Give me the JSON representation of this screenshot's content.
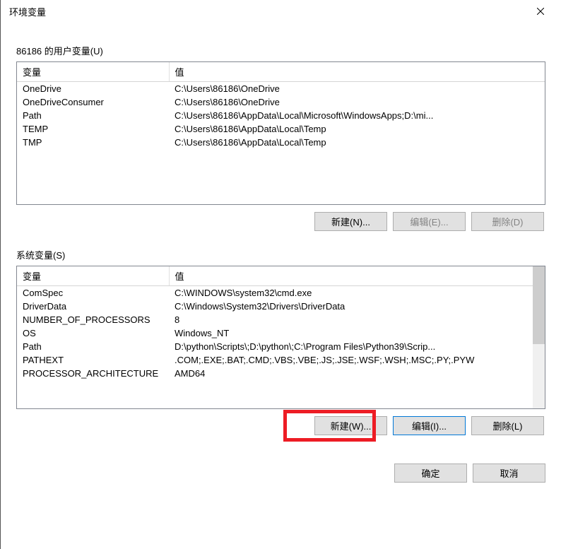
{
  "window": {
    "title": "环境变量"
  },
  "user_section": {
    "label": "86186 的用户变量(U)",
    "columns": {
      "variable": "变量",
      "value": "值"
    },
    "rows": [
      {
        "variable": "OneDrive",
        "value": "C:\\Users\\86186\\OneDrive"
      },
      {
        "variable": "OneDriveConsumer",
        "value": "C:\\Users\\86186\\OneDrive"
      },
      {
        "variable": "Path",
        "value": "C:\\Users\\86186\\AppData\\Local\\Microsoft\\WindowsApps;D:\\mi..."
      },
      {
        "variable": "TEMP",
        "value": "C:\\Users\\86186\\AppData\\Local\\Temp"
      },
      {
        "variable": "TMP",
        "value": "C:\\Users\\86186\\AppData\\Local\\Temp"
      }
    ],
    "buttons": {
      "new": "新建(N)...",
      "edit": "编辑(E)...",
      "delete": "删除(D)"
    }
  },
  "system_section": {
    "label": "系统变量(S)",
    "columns": {
      "variable": "变量",
      "value": "值"
    },
    "rows": [
      {
        "variable": "ComSpec",
        "value": "C:\\WINDOWS\\system32\\cmd.exe"
      },
      {
        "variable": "DriverData",
        "value": "C:\\Windows\\System32\\Drivers\\DriverData"
      },
      {
        "variable": "NUMBER_OF_PROCESSORS",
        "value": "8"
      },
      {
        "variable": "OS",
        "value": "Windows_NT"
      },
      {
        "variable": "Path",
        "value": "D:\\python\\Scripts\\;D:\\python\\;C:\\Program Files\\Python39\\Scrip..."
      },
      {
        "variable": "PATHEXT",
        "value": ".COM;.EXE;.BAT;.CMD;.VBS;.VBE;.JS;.JSE;.WSF;.WSH;.MSC;.PY;.PYW"
      },
      {
        "variable": "PROCESSOR_ARCHITECTURE",
        "value": "AMD64"
      }
    ],
    "buttons": {
      "new": "新建(W)...",
      "edit": "编辑(I)...",
      "delete": "删除(L)"
    }
  },
  "dialog_buttons": {
    "ok": "确定",
    "cancel": "取消"
  }
}
